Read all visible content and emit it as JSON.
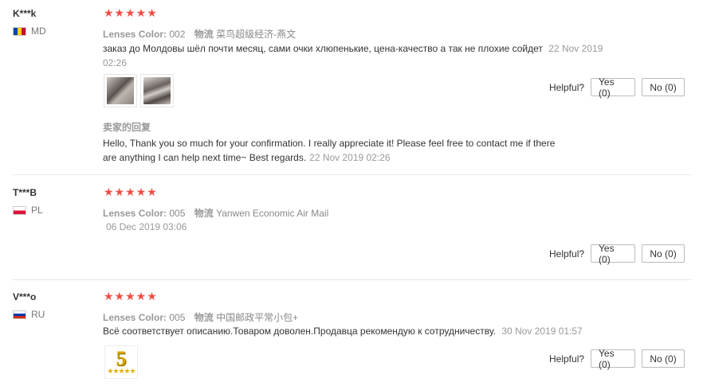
{
  "reviews": [
    {
      "buyer": "K***k",
      "country": "MD",
      "stars": "★★★★★",
      "color_label": "Lenses Color:",
      "color_value": "002",
      "shipping_label": "物流",
      "shipping_value": "菜鸟超级经济-燕文",
      "text_line1": "заказ до Молдовы шёл почти месяц, сами очки хлюпенькие, цена-качество а так не плохие сойдет",
      "date": "22 Nov 2019 02:26",
      "seller_reply_label": "卖家的回复",
      "seller_reply_line1": "Hello, Thank you so much for your confirmation. I really appreciate it! Please feel free to contact me if there",
      "seller_reply_line2": "are anything I can help next time~ Best regards.",
      "seller_reply_date": "22 Nov 2019 02:26",
      "helpful_label": "Helpful?",
      "yes_label": "Yes (0)",
      "no_label": "No (0)"
    },
    {
      "buyer": "T***B",
      "country": "PL",
      "stars": "★★★★★",
      "color_label": "Lenses Color:",
      "color_value": "005",
      "shipping_label": "物流",
      "shipping_value": "Yanwen Economic Air Mail",
      "date": "06 Dec 2019 03:06",
      "helpful_label": "Helpful?",
      "yes_label": "Yes (0)",
      "no_label": "No (0)"
    },
    {
      "buyer": "V***o",
      "country": "RU",
      "stars": "★★★★★",
      "color_label": "Lenses Color:",
      "color_value": "005",
      "shipping_label": "物流",
      "shipping_value": "中国邮政平常小包+",
      "text": "Всё соответствует описанию.Товаром доволен.Продавца рекомендую к сотрудничеству.",
      "date": "30 Nov 2019 01:57",
      "badge_number": "5",
      "badge_stars": "★★★★★",
      "helpful_label": "Helpful?",
      "yes_label": "Yes (0)",
      "no_label": "No (0)"
    }
  ]
}
